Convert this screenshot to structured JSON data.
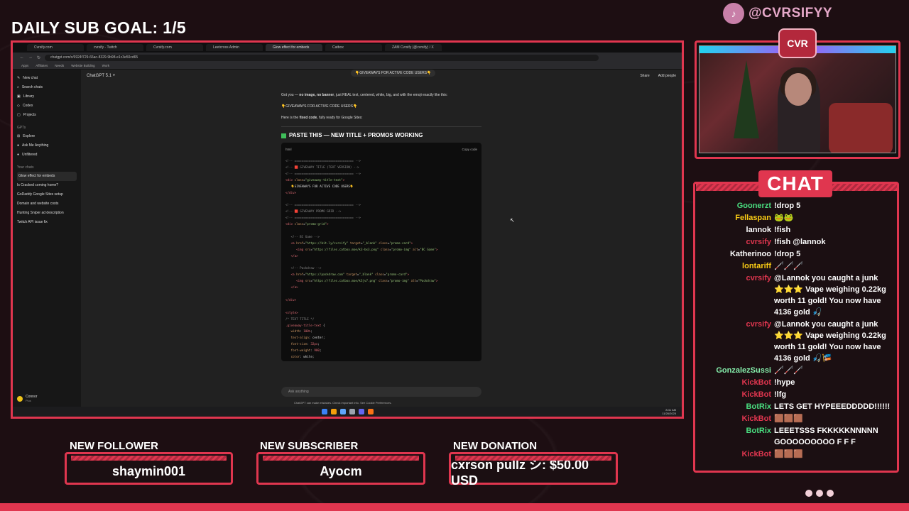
{
  "overlay": {
    "goal": "DAILY SUB GOAL: 1/5",
    "brand": "@CVRSIFYY",
    "badge": "CVR"
  },
  "browser": {
    "tabs": [
      "Cvrsify.com",
      "cvrsify - Twitch",
      "Cvrsify.com",
      "Leetcross Admin",
      "Glow effect for embeds",
      "Catbox",
      "ZAM Cvrsify (@cvrsify) / X"
    ],
    "url": "chatgpt.com/c/6924f729-66ac-8329-9b98-e1c3e50cd65",
    "bookmarks": [
      "Apps",
      "Affiliates",
      "Needs",
      "Website Building",
      "Work"
    ]
  },
  "chatgpt": {
    "model": "ChatGPT 5.1",
    "share": "Share",
    "add_people": "Add people",
    "sidebar": {
      "new_chat": "New chat",
      "search": "Search chats",
      "library": "Library",
      "codex": "Codex",
      "projects": "Projects",
      "gpts_head": "GPTs",
      "explore": "Explore",
      "ask": "Ask Me Anything",
      "unfiltered": "Unfiltered",
      "chats_head": "Your chats",
      "chats": [
        "Glow effect for embeds",
        "Is Cracked coming home?",
        "GoDaddy Google Sites setup",
        "Domain and website costs",
        "Hunting Sniper ad description",
        "Twitch API issue fix"
      ],
      "user": "Connor",
      "plan": "Plus"
    },
    "pill": "👇GIVEAWAYS FOR ACTIVE CODE USERS👇",
    "intro_pre": "Got you — ",
    "intro_bold": "no image, no banner",
    "intro_post": ", just REAL text, centered, white, big, and with the emoji exactly like this:",
    "emoji_line": "👇GIVEAWAYS FOR ACTIVE CODE USERS👇",
    "fixed_pre": "Here is the ",
    "fixed_bold": "fixed code",
    "fixed_post": ", fully ready for Google Sites:",
    "heading": "PASTE THIS — NEW TITLE + PROMOS WORKING",
    "code_lang": "html",
    "copy": "Copy code",
    "input_placeholder": "Ask anything",
    "footer": "ChatGPT can make mistakes. Check important info. See Cookie Preferences.",
    "time": "8:41 AM",
    "date": "11/26/2025"
  },
  "chat": {
    "title": "CHAT",
    "messages": [
      {
        "user": "Goonerzt",
        "color": "#4ade80",
        "text": "!drop 5"
      },
      {
        "user": "Fellaspan",
        "color": "#facc15",
        "text": "🐸🐸"
      },
      {
        "user": "lannok",
        "color": "#ffffff",
        "text": "!fish"
      },
      {
        "user": "cvrsify",
        "color": "#e0364f",
        "text": "!fish @lannok"
      },
      {
        "user": "Katherinoo",
        "color": "#ffffff",
        "text": "!drop 5"
      },
      {
        "user": "lontariff",
        "color": "#facc15",
        "text": "🦯🦯🦯"
      },
      {
        "user": "cvrsify",
        "color": "#e0364f",
        "text": "@Lannok you caught a junk ⭐⭐⭐ Vape weighing 0.22kg worth 11 gold! You now have 4136 gold 🎣"
      },
      {
        "user": "cvrsify",
        "color": "#e0364f",
        "text": "@Lannok you caught a junk ⭐⭐⭐ Vape weighing 0.22kg worth 11 gold! You now have 4136 gold 🎣🎏"
      },
      {
        "user": "GonzalezSussi",
        "color": "#86efac",
        "text": "🦯🦯🦯"
      },
      {
        "user": "KickBot",
        "color": "#e0364f",
        "text": "!hype"
      },
      {
        "user": "KickBot",
        "color": "#e0364f",
        "text": "!lfg"
      },
      {
        "user": "BotRix",
        "color": "#4ade80",
        "text": "LETS GET HYPEEEDDDDD!!!!!!"
      },
      {
        "user": "KickBot",
        "color": "#e0364f",
        "text": "🟫🟫🟫"
      },
      {
        "user": "BotRix",
        "color": "#4ade80",
        "text": "LEEETSSS FKKKKKNNNNN GOOOOOOOOO F F F"
      },
      {
        "user": "KickBot",
        "color": "#e0364f",
        "text": "🟫🟫🟫"
      }
    ]
  },
  "alerts": {
    "follower_label": "NEW FOLLOWER",
    "follower": "shaymin001",
    "subscriber_label": "NEW SUBSCRIBER",
    "subscriber": "Ayocm",
    "donation_label": "NEW DONATION",
    "donation": "cxrson pullz シ: $50.00 USD"
  }
}
